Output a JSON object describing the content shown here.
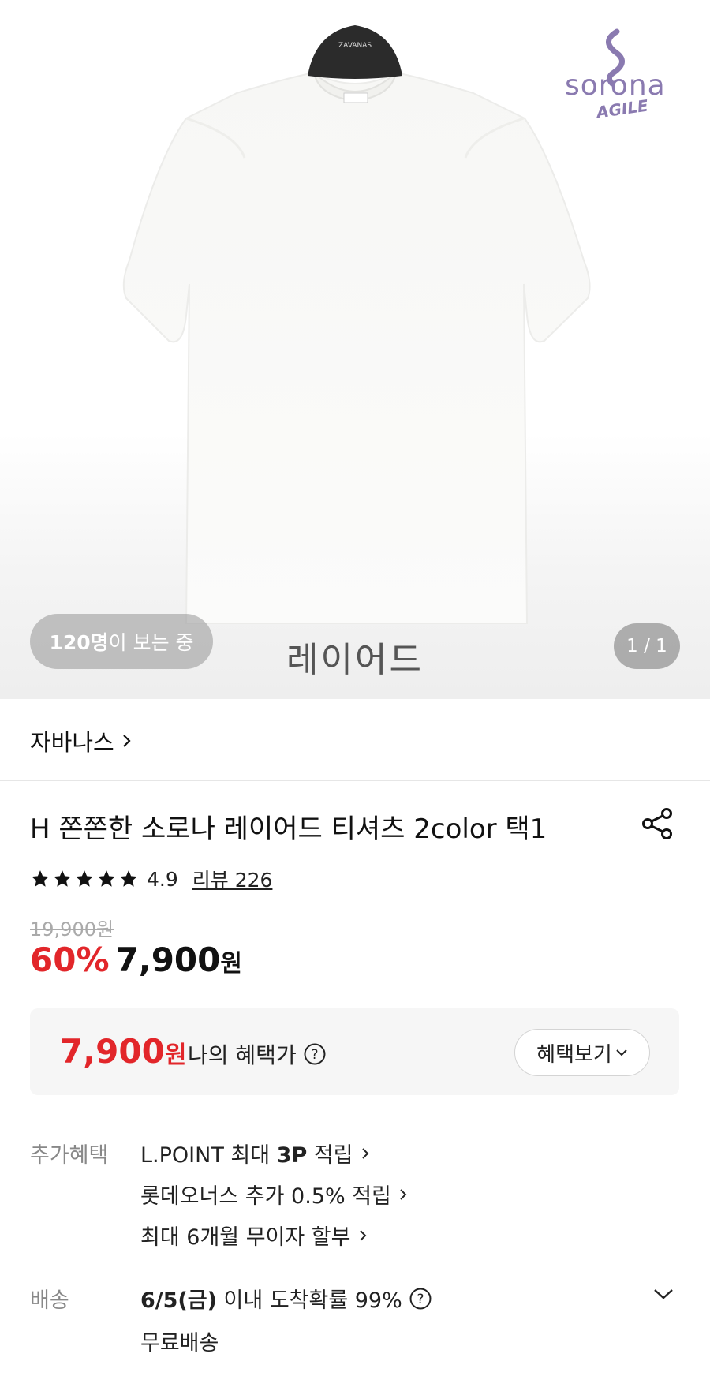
{
  "hero": {
    "brand_logo_text": "sorona",
    "brand_logo_sub": "AGILE",
    "hanger_text": "ZAVANAS",
    "viewers_count": "120명",
    "viewers_suffix": "이 보는 중",
    "caption": "레이어드",
    "pager": "1 / 1"
  },
  "brand": {
    "name": "자바나스",
    "chevron": "chevron-right-icon"
  },
  "product": {
    "title": "H 쫀쫀한 소로나 레이어드 티셔츠 2color 택1",
    "rating": "4.9",
    "stars": 5,
    "review_label": "리뷰 226",
    "original_price": "19,900원",
    "discount": "60%",
    "price": "7,900",
    "currency": "원"
  },
  "benefit": {
    "price": "7,900",
    "currency": "원",
    "label": "나의 혜택가",
    "button_label": "혜택보기"
  },
  "extra_benefits": {
    "label": "추가혜택",
    "lines": [
      {
        "pre": "L.POINT 최대 ",
        "bold": "3P",
        "post": " 적립"
      },
      {
        "pre": "롯데오너스 추가 0.5% 적립",
        "bold": "",
        "post": ""
      },
      {
        "pre": "최대 6개월 무이자 할부",
        "bold": "",
        "post": ""
      }
    ]
  },
  "shipping": {
    "label": "배송",
    "date": "6/5(금)",
    "text": " 이내 도착확률 99%",
    "free": "무료배송"
  },
  "colors": {
    "accent_red": "#e2262a",
    "brand_purple": "#8a7ab0"
  }
}
